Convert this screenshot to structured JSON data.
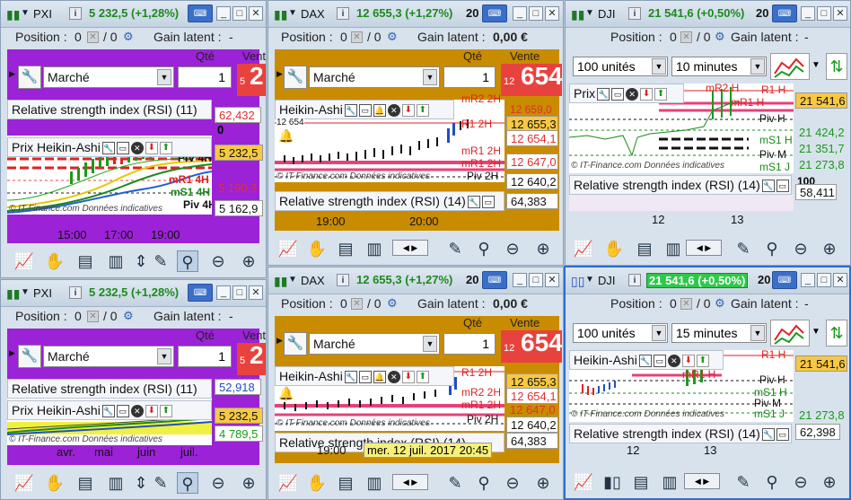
{
  "common": {
    "position_label": "Position :",
    "position_value": "0",
    "position_slash": "/ 0",
    "gain_label": "Gain latent :",
    "order_type": "Marché",
    "qte_label": "Qté",
    "qty_value": "1",
    "vente_label": "Vente MK",
    "copyright": "© IT-Finance.com Données indicatives"
  },
  "panel1": {
    "symbol": "PXI",
    "price": "5 232,5 (+1,28%)",
    "gain": "-",
    "sell_small": "5",
    "sell_big": "2",
    "ind1": "Relative strength index (RSI) (11)",
    "ind1_val": "62,432",
    "ind1_zero": "0",
    "ind2": "Prix Heikin-Ashi",
    "scales": [
      "5 232,5",
      "5 190,3",
      "5 162,9"
    ],
    "times": [
      "15:00",
      "17:00",
      "19:00"
    ],
    "level_labels": [
      "PIV 4H",
      "mR1 4H",
      "mS1 4H",
      "Piv 4H"
    ]
  },
  "panel2": {
    "symbol": "DAX",
    "price": "12 655,3 (+1,27%)",
    "extra": "20",
    "gain": "0,00 €",
    "sell_small": "12",
    "sell_big": "654",
    "ind1": "Heikin-Ashi",
    "ind1_sub": "12 654",
    "scales": [
      "12 659,0",
      "12 655,3",
      "12 654,1",
      "12 647,0",
      "12 640,2"
    ],
    "levels": [
      "mR2 2H",
      "R1 2H",
      "mR1 2H",
      "mR1 2H",
      "Piv 2H"
    ],
    "ind2": "Relative strength index (RSI) (14)",
    "ind2_val": "64,383",
    "times": [
      "19:00",
      "20:00"
    ]
  },
  "panel3": {
    "symbol": "DJI",
    "price": "21 541,6 (+0,50%)",
    "extra": "20",
    "gain": "-",
    "units": "100 unités",
    "interval": "10 minutes",
    "ind1": "Prix",
    "scales": [
      "21 541,6",
      "21 424,2",
      "21 351,7",
      "21 273,8"
    ],
    "levels": [
      "mR2 H",
      "R1 H",
      "mR1 H",
      "Piv H",
      "mS1 H",
      "Piv M",
      "mS1 J"
    ],
    "ind2": "Relative strength index (RSI) (14)",
    "ind2_val": "58,411",
    "ind2_top": "100",
    "times": [
      "12",
      "13"
    ]
  },
  "panel4": {
    "symbol": "PXI",
    "price": "5 232,5 (+1,28%)",
    "gain": "-",
    "sell_small": "5",
    "sell_big": "2",
    "ind1": "Relative strength index (RSI) (11)",
    "ind1_val": "52,918",
    "ind2": "Prix Heikin-Ashi",
    "scales": [
      "5 232,5",
      "4 789,5"
    ],
    "times": [
      "avr.",
      "mai",
      "juin",
      "juil."
    ]
  },
  "panel5": {
    "symbol": "DAX",
    "price": "12 655,3 (+1,27%)",
    "extra": "20",
    "gain": "0,00 €",
    "sell_small": "12",
    "sell_big": "654",
    "ind1": "Heikin-Ashi",
    "scales": [
      "12 655,3",
      "12 654,1",
      "12 647,0",
      "12 640,2"
    ],
    "levels": [
      "R1 2H",
      "mR2 2H",
      "mR1 2H",
      "Piv 2H"
    ],
    "ind2": "Relative strength index (RSI) (14)",
    "ind2_val": "64,383",
    "time1": "19:00",
    "tooltip": "mer. 12 juil. 2017 20:45"
  },
  "panel6": {
    "symbol": "DJI",
    "price": "21 541,6 (+0,50%)",
    "extra": "20",
    "gain": "-",
    "units": "100 unités",
    "interval": "15 minutes",
    "ind1": "Heikin-Ashi",
    "scales": [
      "21 541,6",
      "21 273,8"
    ],
    "levels": [
      "R1 H",
      "mR1 H",
      "Piv H",
      "mS1 H",
      "Piv M",
      "mS1 J"
    ],
    "ind2": "Relative strength index (RSI) (14)",
    "ind2_val": "62,398",
    "times": [
      "12",
      "13"
    ]
  }
}
